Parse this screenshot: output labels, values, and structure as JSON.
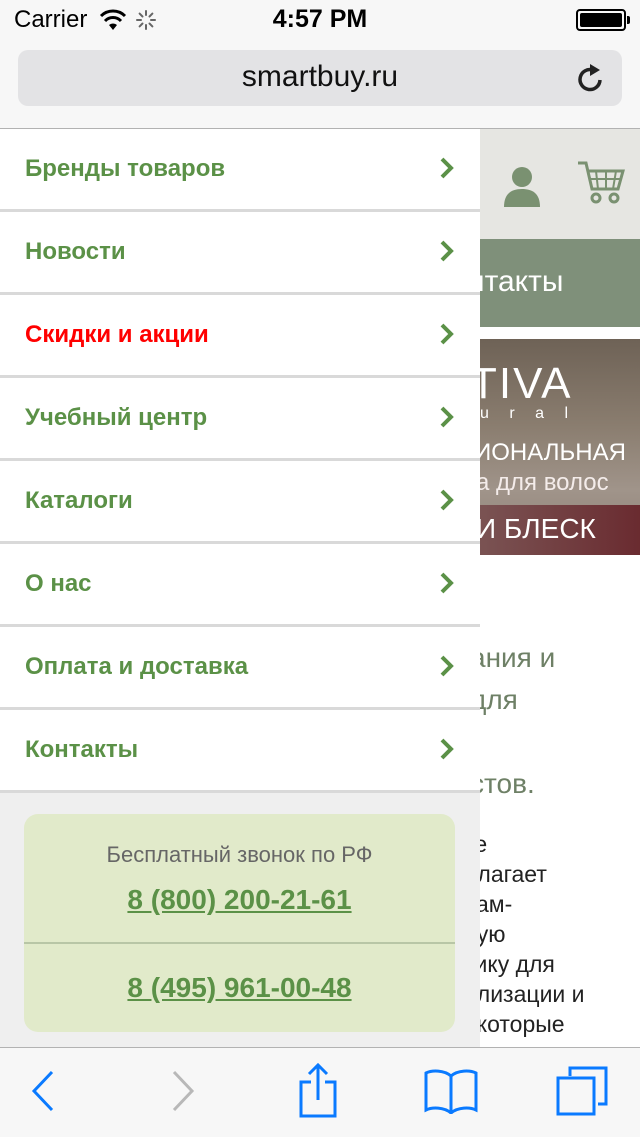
{
  "status_bar": {
    "carrier": "Carrier",
    "time": "4:57 PM",
    "icons": [
      "wifi-icon",
      "activity-spinner-icon",
      "battery-icon"
    ]
  },
  "address_bar": {
    "url": "smartbuy.ru",
    "reload_icon": "reload-icon"
  },
  "menu": {
    "items": [
      {
        "label": "Бренды товаров",
        "highlight": false
      },
      {
        "label": "Новости",
        "highlight": false
      },
      {
        "label": "Скидки и акции",
        "highlight": true
      },
      {
        "label": "Учебный центр",
        "highlight": false
      },
      {
        "label": "Каталоги",
        "highlight": false
      },
      {
        "label": "О нас",
        "highlight": false
      },
      {
        "label": "Оплата и доставка",
        "highlight": false
      },
      {
        "label": "Контакты",
        "highlight": false
      }
    ],
    "call_box": {
      "title": "Бесплатный звонок по РФ",
      "phone_1": "8 (800) 200-21-61",
      "phone_2": "8 (495) 961-00-48"
    }
  },
  "background_page": {
    "nav_fragment": "нтакты",
    "banner": {
      "line1": "TIVA",
      "line2": "u r a l",
      "line3": "ИОНАЛЬНАЯ",
      "line4": "а для волос",
      "line5": "И БЛЕСК"
    },
    "intro_lines": [
      "ания и",
      "для",
      ",",
      "стов."
    ],
    "body_lines": [
      "ке",
      "длагает",
      "чам-",
      "ную",
      "тику для",
      "ализации и",
      ", которые"
    ]
  },
  "toolbar": {
    "icons": [
      "back-icon",
      "forward-icon",
      "share-icon",
      "bookmarks-icon",
      "tabs-icon"
    ]
  },
  "colors": {
    "menu_text": "#5b9147",
    "menu_highlight": "#ff0000",
    "call_box_bg": "#e1eaca",
    "ios_blue": "#0a7aff",
    "page_nav_bg": "#7f907a"
  }
}
